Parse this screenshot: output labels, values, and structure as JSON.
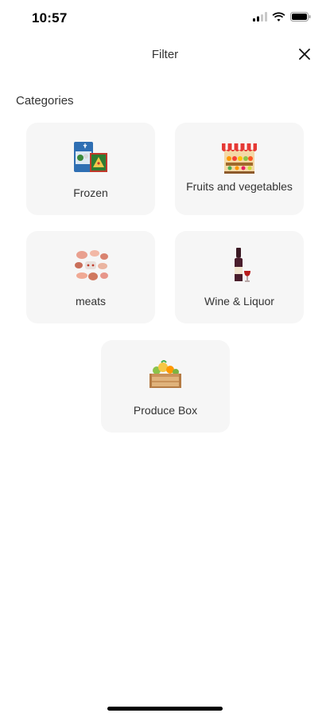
{
  "status_bar": {
    "time": "10:57",
    "icons": [
      "signal-icon",
      "wifi-icon",
      "battery-icon"
    ]
  },
  "header": {
    "title": "Filter",
    "close_icon": "close-icon"
  },
  "section": {
    "label": "Categories"
  },
  "categories": [
    {
      "label": "Frozen",
      "icon": "frozen-food-icon"
    },
    {
      "label": "Fruits and vegetables",
      "icon": "produce-stand-icon"
    },
    {
      "label": "meats",
      "icon": "meats-icon"
    },
    {
      "label": "Wine & Liquor",
      "icon": "wine-bottle-icon"
    },
    {
      "label": "Produce Box",
      "icon": "produce-crate-icon"
    }
  ],
  "colors": {
    "card_background": "#f6f6f6",
    "text": "#333333",
    "background": "#ffffff"
  }
}
